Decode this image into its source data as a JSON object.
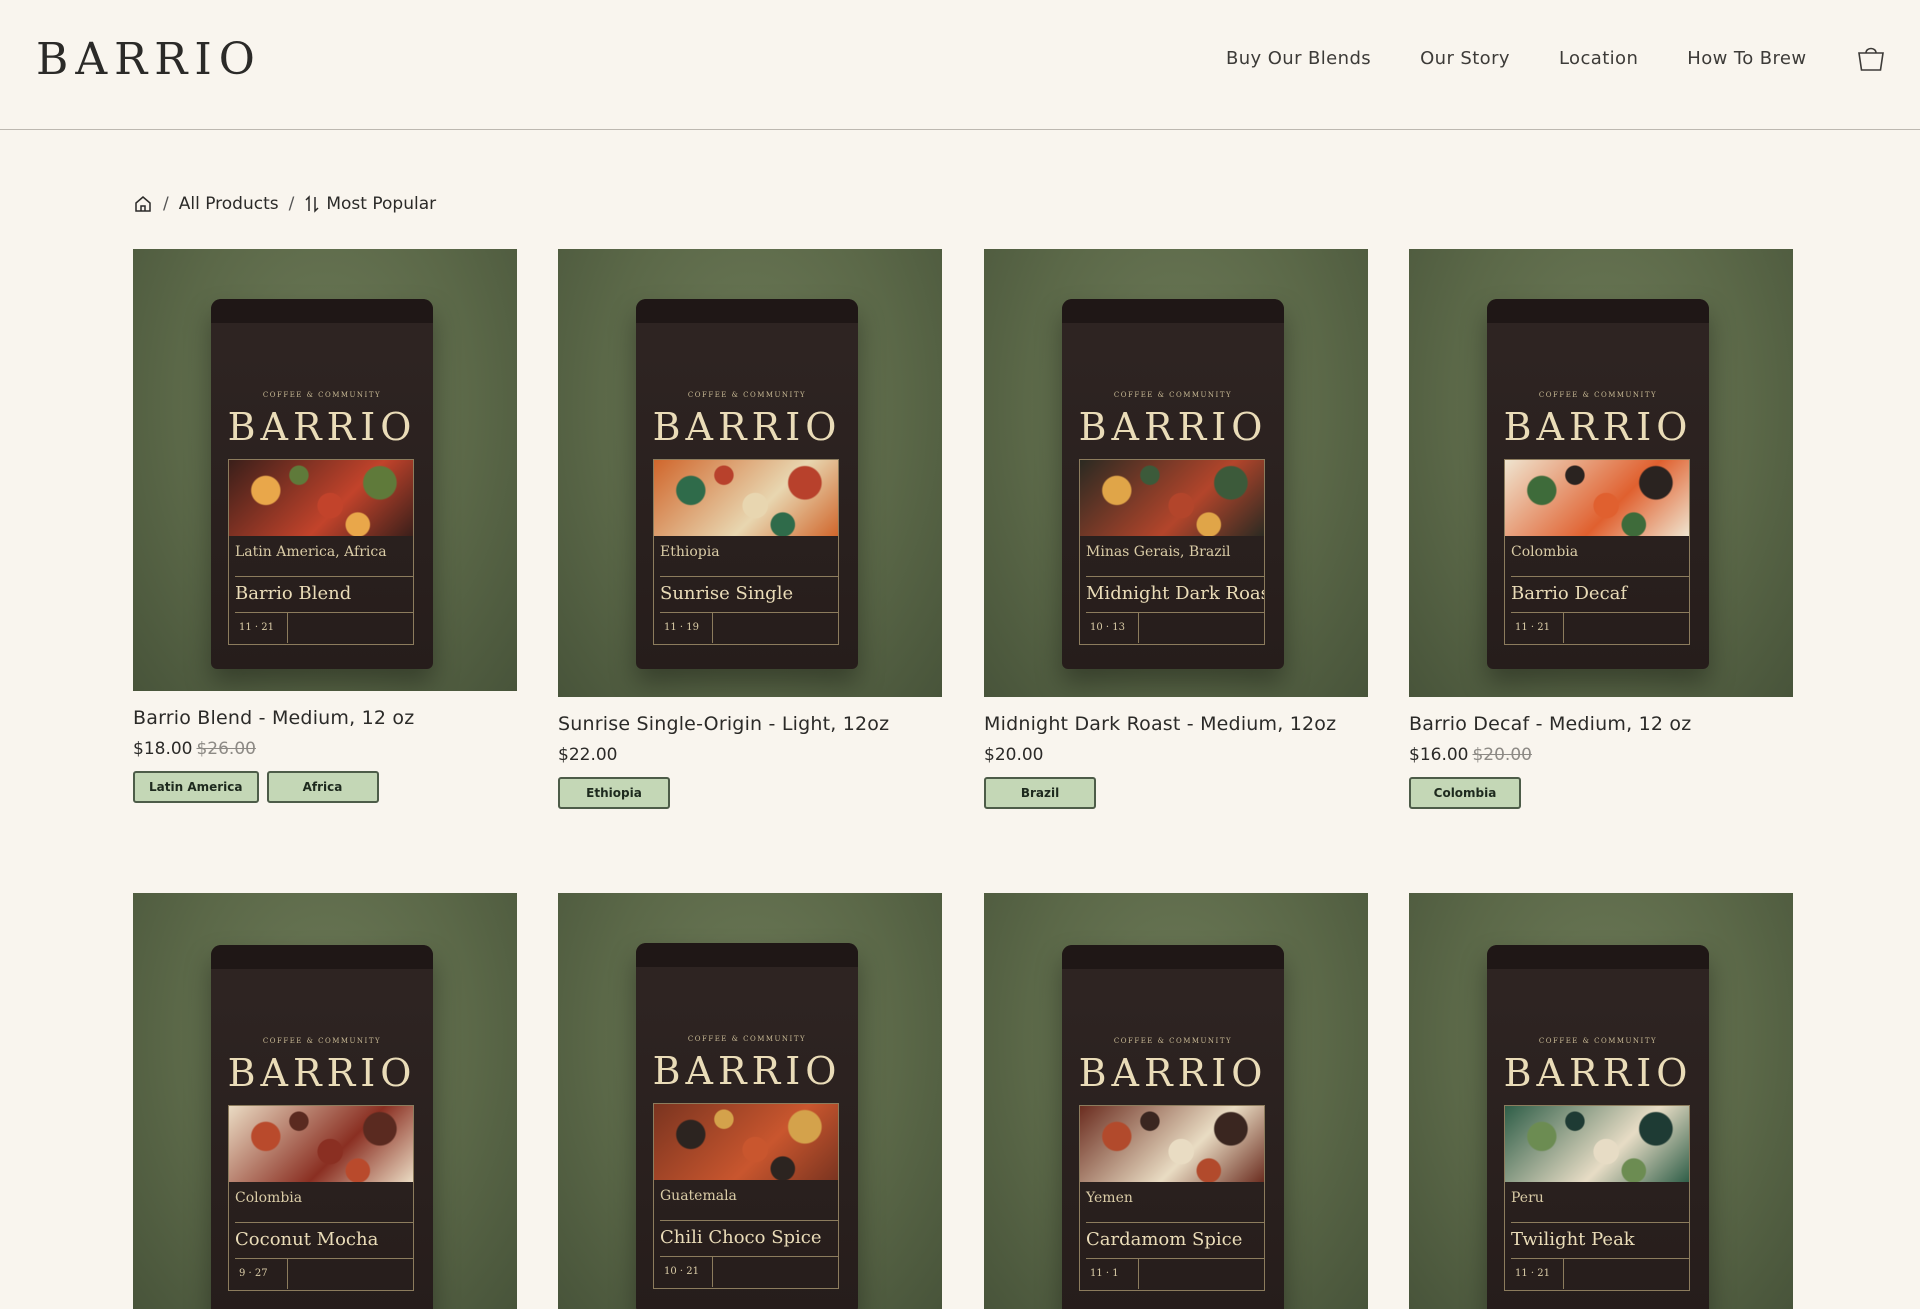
{
  "header": {
    "logo": "BARRIO",
    "nav": [
      "Buy Our Blends",
      "Our Story",
      "Location",
      "How To Brew"
    ]
  },
  "breadcrumb": {
    "all_products": "All Products",
    "sort": "Most Popular"
  },
  "bag_label": {
    "tagline": "COFFEE & COMMUNITY",
    "brand": "BARRIO"
  },
  "products": [
    {
      "title": "Barrio Blend - Medium, 12 oz",
      "price": "$18.00",
      "old_price": "$26.00",
      "badges": [
        "Latin America",
        "Africa"
      ],
      "bag_origin": "Latin America, Africa",
      "bag_name": "Barrio Blend",
      "roast_date": "11 · 21",
      "art_colors": [
        "#3a1f1a",
        "#c2432b",
        "#e9a74a",
        "#5f7a3a"
      ]
    },
    {
      "title": "Sunrise Single-Origin - Light, 12oz",
      "price": "$22.00",
      "old_price": "",
      "badges": [
        "Ethiopia"
      ],
      "bag_origin": "Ethiopia",
      "bag_name": "Sunrise Single",
      "roast_date": "11 · 19",
      "art_colors": [
        "#d0662c",
        "#e8d6b0",
        "#2f6b4a",
        "#b8412c"
      ]
    },
    {
      "title": "Midnight Dark Roast - Medium, 12oz",
      "price": "$20.00",
      "old_price": "",
      "badges": [
        "Brazil"
      ],
      "bag_origin": "Minas Gerais, Brazil",
      "bag_name": "Midnight Dark Roast",
      "roast_date": "10 · 13",
      "art_colors": [
        "#2b2a22",
        "#b3452b",
        "#e0a548",
        "#3c5a3a"
      ]
    },
    {
      "title": "Barrio Decaf - Medium, 12 oz",
      "price": "$16.00",
      "old_price": "$20.00",
      "badges": [
        "Colombia"
      ],
      "bag_origin": "Colombia",
      "bag_name": "Barrio Decaf",
      "roast_date": "11 · 21",
      "art_colors": [
        "#efe4cf",
        "#e0602f",
        "#3e6b3a",
        "#2a2320"
      ]
    },
    {
      "bag_origin": "Colombia",
      "bag_name": "Coconut Mocha",
      "roast_date": "9 · 27",
      "art_colors": [
        "#eadbc3",
        "#8a2f22",
        "#b94a2c",
        "#5a2a20"
      ]
    },
    {
      "bag_origin": "Guatemala",
      "bag_name": "Chili Choco Spice",
      "roast_date": "10 · 21",
      "art_colors": [
        "#7a3420",
        "#c9562e",
        "#2c2420",
        "#d4a24b"
      ]
    },
    {
      "bag_origin": "Yemen",
      "bag_name": "Cardamom Spice",
      "roast_date": "11 · 1",
      "art_colors": [
        "#6b2d20",
        "#e9dcc3",
        "#b24a2c",
        "#3a2620"
      ]
    },
    {
      "bag_origin": "Peru",
      "bag_name": "Twilight Peak",
      "roast_date": "11 · 21",
      "art_colors": [
        "#2f5e48",
        "#e7dcc5",
        "#6c8c52",
        "#1e3b34"
      ]
    }
  ]
}
